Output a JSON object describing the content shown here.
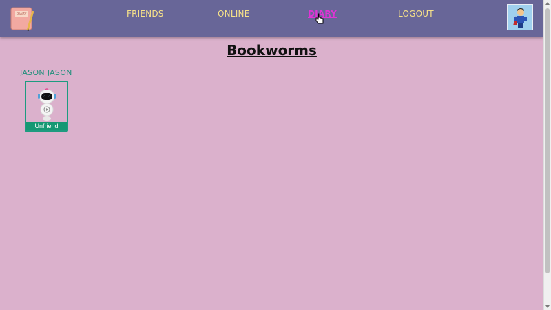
{
  "nav": {
    "items": [
      "FRIENDS",
      "ONLINE",
      "DIARY",
      "LOGOUT"
    ],
    "active": "DIARY",
    "logo_icon": "diary-notebook-icon",
    "logo_text": "DIARY",
    "avatar_icon": "superhero-avatar-icon"
  },
  "page": {
    "title": "Bookworms"
  },
  "friends": [
    {
      "name": "JASON JASON",
      "avatar_icon": "robot-avatar-icon",
      "action": "Unfriend"
    }
  ],
  "colors": {
    "background": "#dbb1cc",
    "navbar": "#686698",
    "nav_text": "#f7e289",
    "active_nav": "#e033d6",
    "accent_green": "#169873"
  }
}
